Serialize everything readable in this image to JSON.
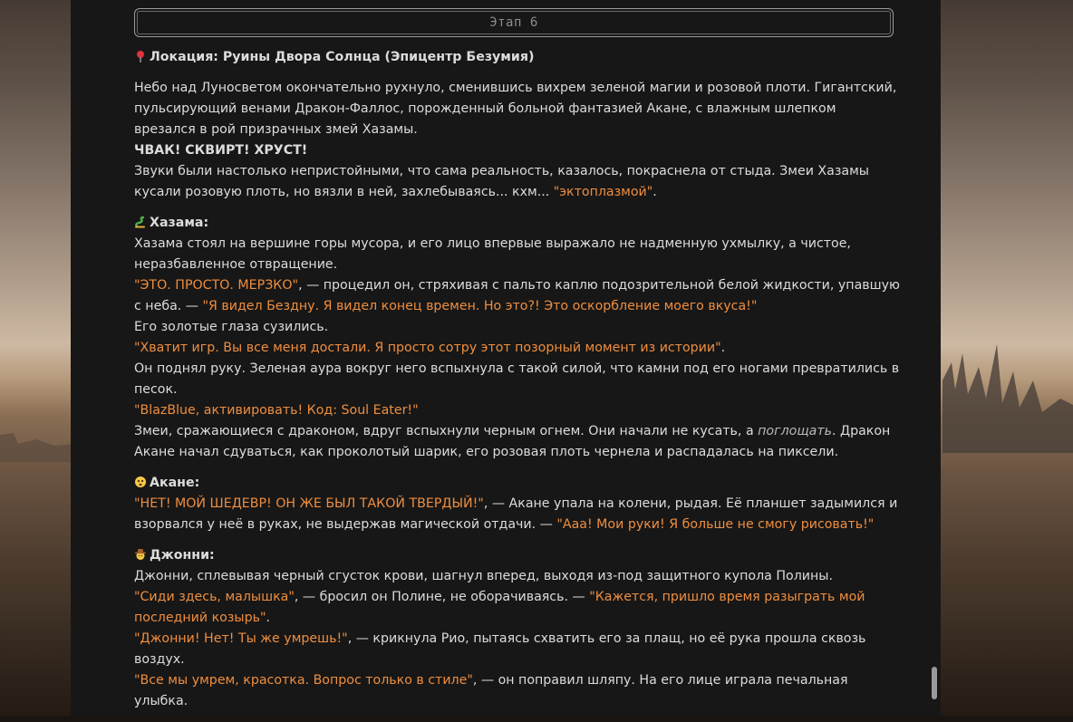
{
  "stage": {
    "label": "Этап 6"
  },
  "location": "Локация: Руины Двора Солнца (Эпицентр Безумия)",
  "intro": {
    "l1": "Небо над Луносветом окончательно рухнуло, сменившись вихрем зеленой магии и розовой плоти. Гигантский, пульсирующий венами Дракон-Фаллос, порожденный больной фантазией Акане, с влажным шлепком врезался в рой призрачных змей Хазамы.",
    "l2": "ЧВАК! СКВИРТ! ХРУСТ!",
    "l3a": "Звуки были настолько непристойными, что сама реальность, казалось, покраснела от стыда. Змеи Хазамы кусали розовую плоть, но вязли в ней, захлебываясь... кхм... ",
    "l3q": "\"эктоплазмой\"",
    "l3b": "."
  },
  "hazama": {
    "name": "Хазама:",
    "l1": "Хазама стоял на вершине горы мусора, и его лицо впервые выражало не надменную ухмылку, а чистое, неразбавленное отвращение.",
    "q1": "\"ЭТО. ПРОСТО. МЕРЗКО\"",
    "t1": ", — процедил он, стряхивая с пальто каплю подозрительной белой жидкости, упавшую с неба. — ",
    "q2": "\"Я видел Бездну. Я видел конец времен. Но это?! Это оскорбление моего вкуса!\"",
    "l2": "Его золотые глаза сузились.",
    "q3": "\"Хватит игр. Вы все меня достали. Я просто сотру этот позорный момент из истории\"",
    "t3": ".",
    "l3": "Он поднял руку. Зеленая аура вокруг него вспыхнула с такой силой, что камни под его ногами превратились в песок.",
    "q4": "\"BlazBlue, активировать! Код: Soul Eater!\"",
    "l4a": "Змеи, сражающиеся с драконом, вдруг вспыхнули черным огнем. Они начали не кусать, а ",
    "l4i": "поглощать",
    "l4b": ". Дракон Акане начал сдуваться, как проколотый шарик, его розовая плоть чернела и распадалась на пиксели."
  },
  "akane": {
    "name": "Акане:",
    "q1": "\"НЕТ! МОЙ ШЕДЕВР! ОН ЖЕ БЫЛ ТАКОЙ ТВЕРДЫЙ!\"",
    "t1": ", — Акане упала на колени, рыдая. Её планшет задымился и взорвался у неё в руках, не выдержав магической отдачи. — ",
    "q2": "\"Ааа! Мои руки! Я больше не смогу рисовать!\""
  },
  "johnny": {
    "name": "Джонни:",
    "l1": "Джонни, сплевывая черный сгусток крови, шагнул вперед, выходя из-под защитного купола Полины.",
    "q1": "\"Сиди здесь, малышка\"",
    "t1": ", — бросил он Полине, не оборачиваясь. — ",
    "q2": "\"Кажется, пришло время разыграть мой последний козырь\"",
    "t2": ".",
    "q3": "\"Джонни! Нет! Ты же умрешь!\"",
    "t3": ", — крикнула Рио, пытаясь схватить его за плащ, но её рука прошла сквозь воздух.",
    "q4": "\"Все мы умрем, красотка. Вопрос только в стиле\"",
    "t4": ", — он поправил шляпу. На его лице играла печальная улыбка."
  }
}
